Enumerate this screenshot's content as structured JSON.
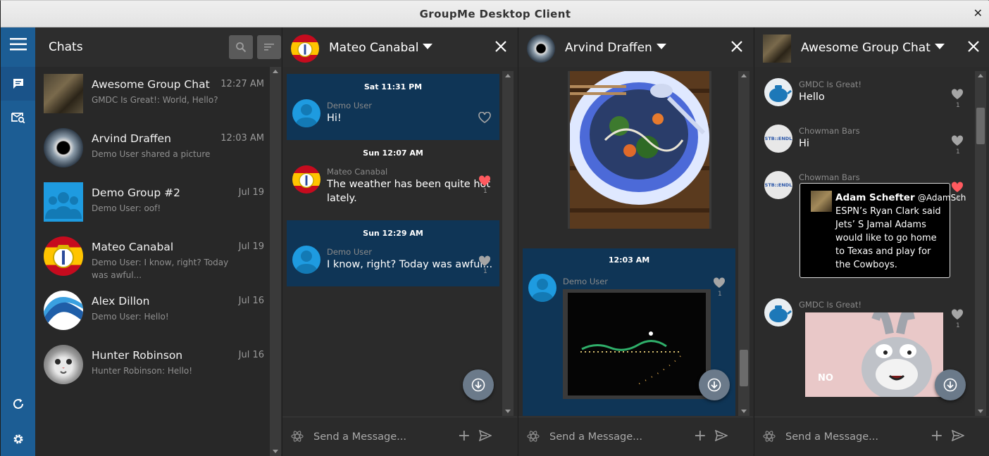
{
  "window": {
    "title": "GroupMe Desktop Client",
    "close_glyph": "✕"
  },
  "rail": {
    "icons": [
      "menu-icon",
      "chat-icon",
      "search-mail-icon",
      "refresh-icon",
      "settings-icon"
    ]
  },
  "chat_list": {
    "title": "Chats",
    "items": [
      {
        "name": "Awesome Group Chat",
        "time": "12:27 AM",
        "preview": "GMDC Is Great!: World, Hello?"
      },
      {
        "name": "Arvind Draffen",
        "time": "12:03 AM",
        "preview": "Demo User shared a picture"
      },
      {
        "name": "Demo Group #2",
        "time": "Jul 19",
        "preview": "Demo User: oof!"
      },
      {
        "name": "Mateo Canabal",
        "time": "Jul 19",
        "preview": "Demo User: I know, right? Today was awful..."
      },
      {
        "name": "Alex Dillon",
        "time": "Jul 16",
        "preview": "Demo User: Hello!"
      },
      {
        "name": "Hunter Robinson",
        "time": "Jul 16",
        "preview": "Hunter Robinson: Hello!"
      }
    ]
  },
  "panes": [
    {
      "title": "Mateo Canabal",
      "composer_placeholder": "Send a Message...",
      "groups": [
        {
          "stamp": "Sat 11:31 PM",
          "sender": "Demo User",
          "text": "Hi!",
          "likes": ""
        },
        {
          "stamp": "Sun 12:07 AM",
          "sender": "Mateo Canabal",
          "text_line1": "The weather has been quite hot",
          "text_line2": "lately.",
          "likes": "1"
        },
        {
          "stamp": "Sun 12:29 AM",
          "sender": "Demo User",
          "text": "I know, right? Today was awful...",
          "likes": "1"
        }
      ]
    },
    {
      "title": "Arvind Draffen",
      "composer_placeholder": "Send a Message...",
      "stamp": "12:03 AM",
      "sender": "Demo User",
      "likes": "1"
    },
    {
      "title": "Awesome Group Chat",
      "composer_placeholder": "Send a Message...",
      "messages": [
        {
          "sender": "GMDC Is Great!",
          "text": "Hello",
          "likes": "1"
        },
        {
          "sender": "Chowman Bars",
          "text": "Hi",
          "likes": "1"
        },
        {
          "sender": "Chowman Bars",
          "likes": "3"
        },
        {
          "sender": "GMDC Is Great!",
          "likes": "1"
        }
      ],
      "tweet": {
        "author": "Adam Schefter",
        "handle": "@AdamSch",
        "body": "ESPN’s Ryan Clark said Jets’ S Jamal Adams would like to go home to Texas and play for the Cowboys."
      },
      "avatar_text": "STB::ENDL",
      "meme_caption": "NO"
    }
  ],
  "colors": {
    "rail": "#1c5d94",
    "bubble": "#0f3556",
    "heart_red": "#ff5a5f"
  }
}
